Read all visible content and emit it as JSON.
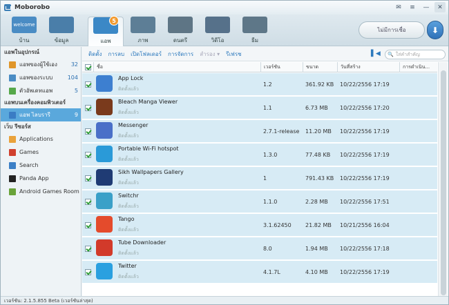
{
  "app": {
    "title": "Moborobo"
  },
  "window_buttons": [
    {
      "name": "message-icon",
      "glyph": "✉"
    },
    {
      "name": "menu-icon",
      "glyph": "≡"
    },
    {
      "name": "minimize-icon",
      "glyph": "—"
    },
    {
      "name": "close-icon",
      "glyph": "✕"
    }
  ],
  "toolbar": {
    "items": [
      {
        "label": "บ้าน",
        "icon": "home-icon",
        "color": "#4a8cc4"
      },
      {
        "label": "ข้อมูล",
        "icon": "data-icon",
        "color": "#4a7ea9"
      },
      {
        "label": "แอพ",
        "icon": "apps-icon",
        "color": "#3b88c6",
        "badge": "5"
      },
      {
        "label": "ภาพ",
        "icon": "photo-icon",
        "color": "#5d7e96"
      },
      {
        "label": "ดนตรี",
        "icon": "music-icon",
        "color": "#5e7585"
      },
      {
        "label": "วิดีโอ",
        "icon": "video-icon",
        "color": "#56718a"
      },
      {
        "label": "ธีม",
        "icon": "theme-icon",
        "color": "#5e7788"
      }
    ],
    "home_icon_text": "welcome",
    "connect_label": "ไม่มีการเชื่อ",
    "download_glyph": "⬇"
  },
  "sidebar": {
    "section1": "แอพในอุปกรณ์",
    "device_items": [
      {
        "label": "แอพของผู้ใช้เอง",
        "count": "32",
        "color": "#e0962a"
      },
      {
        "label": "แอพของระบบ",
        "count": "104",
        "color": "#4a8cc4"
      },
      {
        "label": "ตัวอัพเดทแอพ",
        "count": "5",
        "color": "#56a84a"
      }
    ],
    "section2": "แอพบนเครื่องคอมพิวเตอร์",
    "pc_items": [
      {
        "label": "แอพ ไลบรารี",
        "count": "9",
        "color": "#3a7cc4"
      }
    ],
    "section3": "เว็บ รีซอร์ส",
    "web_items": [
      {
        "label": "Applications",
        "color": "#e9a23b"
      },
      {
        "label": "Games",
        "color": "#d0402e"
      },
      {
        "label": "Search",
        "color": "#3b7fc6"
      },
      {
        "label": "Panda App",
        "color": "#222222"
      },
      {
        "label": "Android Games Room",
        "color": "#6aa33a"
      }
    ]
  },
  "subbar": {
    "actions": [
      "ติดตั้ง",
      "การลบ",
      "เปิดโฟลเดอร์",
      "การจัดการ",
      "สำรอง",
      "รีเฟรช"
    ],
    "search_placeholder": "ใส่คำสำคัญ"
  },
  "table": {
    "columns": [
      "ชื่อ",
      "เวอร์ชัน",
      "ขนาด",
      "วันที่สร้าง",
      "การดำเนิน..."
    ],
    "status_text": "ติดตั้งแล้ว",
    "rows": [
      {
        "name": "App Lock",
        "version": "1.2",
        "size": "361.92 KB",
        "date": "10/22/2556 17:19",
        "color": "#3d7fd0"
      },
      {
        "name": "Bleach Manga Viewer",
        "version": "1.1",
        "size": "6.73 MB",
        "date": "10/22/2556 17:20",
        "color": "#7a3a1c"
      },
      {
        "name": "Messenger",
        "version": "2.7.1-release",
        "size": "11.20 MB",
        "date": "10/22/2556 17:19",
        "color": "#4a70c8"
      },
      {
        "name": "Portable Wi-Fi hotspot",
        "version": "1.3.0",
        "size": "77.48 KB",
        "date": "10/22/2556 17:19",
        "color": "#2a9ad8"
      },
      {
        "name": "Sikh Wallpapers Gallery",
        "version": "1",
        "size": "791.43 KB",
        "date": "10/22/2556 17:19",
        "color": "#1f3b74"
      },
      {
        "name": "Switchr",
        "version": "1.1.0",
        "size": "2.28 MB",
        "date": "10/22/2556 17:51",
        "color": "#3aa0c8"
      },
      {
        "name": "Tango",
        "version": "3.1.62450",
        "size": "21.82 MB",
        "date": "10/21/2556 16:04",
        "color": "#e44b2c"
      },
      {
        "name": "Tube Downloader",
        "version": "8.0",
        "size": "1.94 MB",
        "date": "10/22/2556 17:18",
        "color": "#d23a2a"
      },
      {
        "name": "Twitter",
        "version": "4.1.7L",
        "size": "4.10 MB",
        "date": "10/22/2556 17:19",
        "color": "#2aa0e0"
      }
    ]
  },
  "status": {
    "text": "เวอร์ชัน: 2.1.5.855 Beta (เวอร์ชันล่าสุด)"
  }
}
